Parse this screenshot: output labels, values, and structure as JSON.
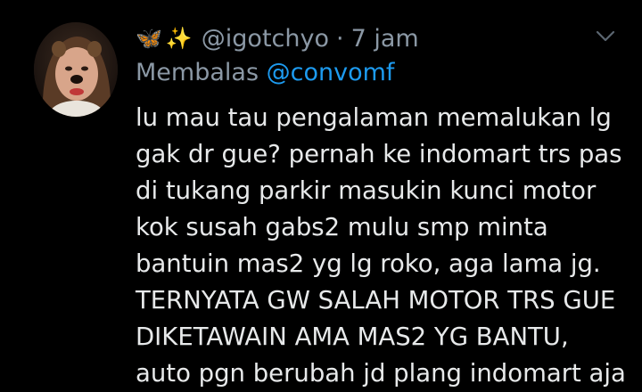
{
  "tweet": {
    "emoji_1": "🦋",
    "emoji_2": "✨",
    "handle": "@igotchyo",
    "separator": "·",
    "time": "7 jam",
    "reply_prefix": "Membalas",
    "reply_mention": "@convomf",
    "text_lines": [
      "lu mau tau pengalaman memalukan lg",
      "gak dr gue? pernah ke indomart trs pas",
      "di tukang parkir masukin kunci motor",
      "kok susah gabs2 mulu smp minta",
      "bantuin mas2 yg lg roko, aga lama jg.",
      "TERNYATA GW SALAH MOTOR TRS GUE",
      "DIKETAWAIN AMA MAS2 YG BANTU,",
      "auto pgn berubah jd plang indomart aja"
    ]
  },
  "icons": {
    "avatar": "profile-photo",
    "menu": "chevron-down-icon"
  },
  "colors": {
    "background": "#000000",
    "text": "#e7e9ea",
    "secondary": "#8b98a5",
    "link": "#1d9bf0"
  }
}
